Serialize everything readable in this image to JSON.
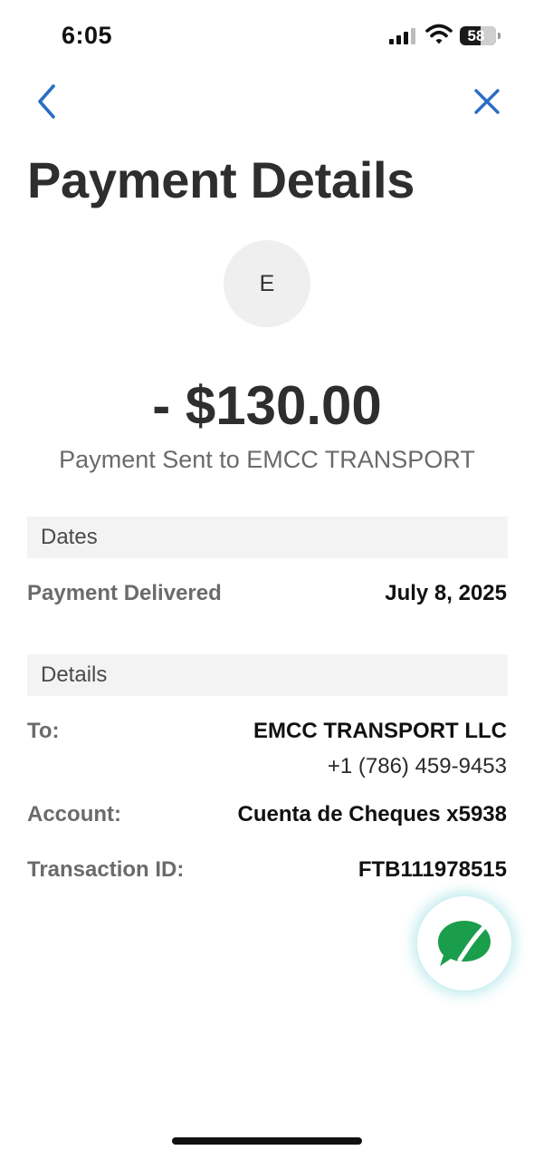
{
  "status_bar": {
    "time": "6:05",
    "battery": "58"
  },
  "nav": {
    "back_icon": "chevron-left-icon",
    "close_icon": "close-icon",
    "accent_color": "#2b6cc4"
  },
  "header": {
    "title": "Payment Details"
  },
  "payee": {
    "avatar_initial": "E",
    "amount": "- $130.00",
    "subtitle": "Payment Sent to EMCC TRANSPORT"
  },
  "dates": {
    "section_label": "Dates",
    "delivered_label": "Payment Delivered",
    "delivered_value": "July 8, 2025"
  },
  "details": {
    "section_label": "Details",
    "to_label": "To:",
    "to_name": "EMCC TRANSPORT LLC",
    "to_phone": "+1 (786) 459-9453",
    "account_label": "Account:",
    "account_value": "Cuenta de Cheques x5938",
    "transaction_label": "Transaction ID:",
    "transaction_value": "FTB111978515"
  },
  "chat": {
    "icon": "chat-bubble-icon",
    "color": "#1a9e4b"
  }
}
